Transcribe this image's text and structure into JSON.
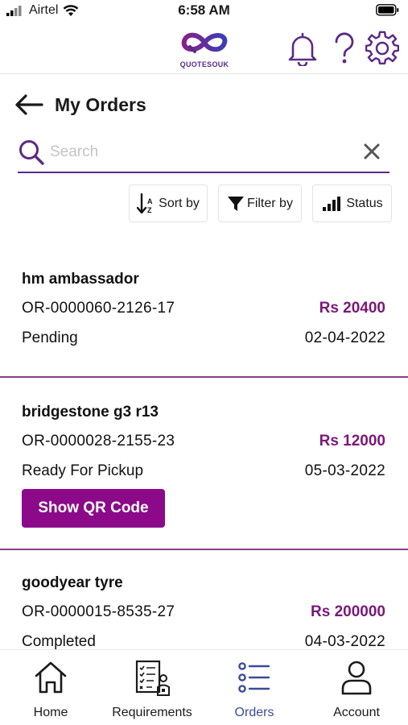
{
  "status_bar": {
    "carrier": "Airtel",
    "time": "6:58 AM"
  },
  "header": {
    "logo_text": "QUOTESOUK",
    "brand_color": "#5b2a86",
    "icons": [
      "bell-icon",
      "help-icon",
      "gear-icon"
    ]
  },
  "page": {
    "title": "My Orders"
  },
  "search": {
    "placeholder": "Search",
    "value": ""
  },
  "filters": {
    "sort_label": "Sort by",
    "filter_label": "Filter by",
    "status_label": "Status"
  },
  "orders": [
    {
      "name": "hm ambassador",
      "id": "OR-0000060-2126-17",
      "price": "Rs 20400",
      "status": "Pending",
      "date": "02-04-2022"
    },
    {
      "name": "bridgestone g3 r13",
      "id": "OR-0000028-2155-23",
      "price": "Rs 12000",
      "status": "Ready For Pickup",
      "date": "05-03-2022",
      "action_label": "Show QR Code"
    },
    {
      "name": "goodyear tyre",
      "id": "OR-0000015-8535-27",
      "price": "Rs 200000",
      "status": "Completed",
      "date": "04-03-2022"
    }
  ],
  "colors": {
    "accent": "#8c0a8a",
    "price": "#7b1878",
    "divider": "#8a3f86",
    "nav_active": "#3b4a9a"
  },
  "bottom_nav": {
    "items": [
      {
        "label": "Home",
        "icon": "home-icon"
      },
      {
        "label": "Requirements",
        "icon": "requirements-icon"
      },
      {
        "label": "Orders",
        "icon": "orders-icon",
        "active": true
      },
      {
        "label": "Account",
        "icon": "account-icon"
      }
    ]
  }
}
